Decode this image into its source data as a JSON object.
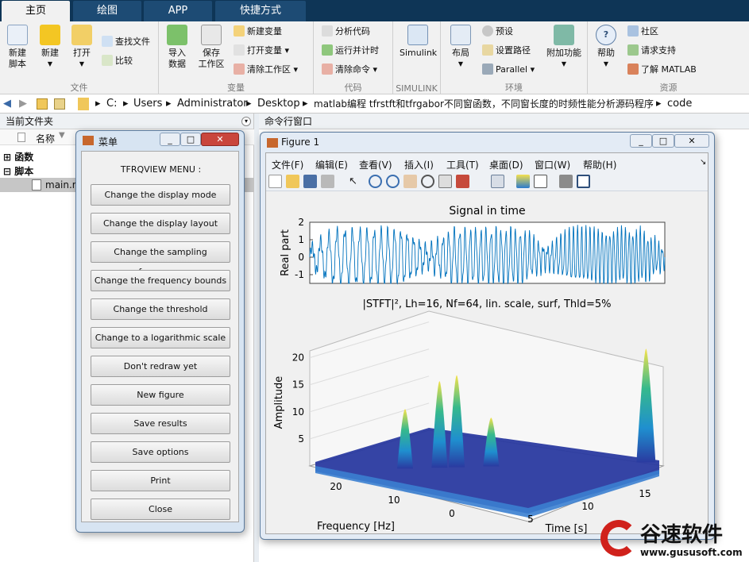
{
  "tabs": [
    "主页",
    "绘图",
    "APP",
    "快捷方式"
  ],
  "ribbon": {
    "groups": {
      "file": "文件",
      "variable": "变量",
      "code": "代码",
      "simulink": "SIMULINK",
      "env": "环境",
      "resource": "资源"
    },
    "new_script": "新建\n脚本",
    "new": "新建",
    "open": "打开",
    "find_files": "查找文件",
    "compare": "比较",
    "import_data": "导入\n数据",
    "save_ws": "保存\n工作区",
    "new_var": "新建变量",
    "open_var": "打开变量",
    "clear_ws": "清除工作区",
    "analyze_code": "分析代码",
    "run_time": "运行并计时",
    "clear_cmd": "清除命令",
    "simulink": "Simulink",
    "layout": "布局",
    "preferences": "预设",
    "set_path": "设置路径",
    "parallel": "Parallel",
    "addons": "附加功能",
    "help": "帮助",
    "community": "社区",
    "request_support": "请求支持",
    "learn_matlab": "了解 MATLAB"
  },
  "address": [
    "C:",
    "Users",
    "Administrator",
    "Desktop",
    "matlab编程 tfrstft和tfrgabor不同窗函数，不同窗长度的时频性能分析源码程序",
    "code"
  ],
  "left_pane": {
    "title": "当前文件夹",
    "col_name": "名称",
    "rows": [
      "函数",
      "脚本",
      "main.m"
    ]
  },
  "right_pane": {
    "title": "命令行窗口"
  },
  "menu_window": {
    "title": "菜单",
    "heading": "TFRQVIEW MENU :",
    "buttons": [
      "Change the display mode",
      "Change the display layout",
      "Change the sampling frequency",
      "Change the frequency bounds",
      "Change the threshold",
      "Change to a logarithmic scale",
      "Don't redraw yet",
      "New figure",
      "Save results",
      "Save options",
      "Print",
      "Close"
    ]
  },
  "figure": {
    "title": "Figure 1",
    "menus": [
      "文件(F)",
      "编辑(E)",
      "查看(V)",
      "插入(I)",
      "工具(T)",
      "桌面(D)",
      "窗口(W)",
      "帮助(H)"
    ]
  },
  "chart_data": [
    {
      "type": "line",
      "title": "Signal in time",
      "ylabel": "Real part",
      "ylim": [
        -1.5,
        2
      ],
      "yticks": [
        2,
        1,
        0,
        -1
      ],
      "series": [
        {
          "values": "oscillatory signal, amplitude about ±1.5, two quieter gaps near 1/3 and 2/3 of the time span"
        }
      ]
    },
    {
      "type": "area",
      "title": "|STFT|², Lh=16, Nf=64, lin. scale, surf, Thld=5%",
      "xlabel": "Time [s]",
      "ylabel": "Frequency [Hz]",
      "zlabel": "Amplitude",
      "xticks": [
        5,
        10,
        15
      ],
      "yticks": [
        20,
        10,
        0
      ],
      "zticks": [
        20,
        15,
        10,
        5
      ],
      "zlim": [
        0,
        22
      ],
      "peaks": [
        {
          "time": 3,
          "amplitude": 11
        },
        {
          "time": 5,
          "amplitude": 16
        },
        {
          "time": 6,
          "amplitude": 17
        },
        {
          "time": 8,
          "amplitude": 9
        },
        {
          "time": 17,
          "amplitude": 21
        }
      ]
    }
  ],
  "logo": {
    "brand": "谷速软件",
    "url": "www.gususoft.com"
  },
  "colors": {
    "tabbar": "#0e3556",
    "plot": "#0072bd",
    "ribbon": "#f1f1f1"
  }
}
